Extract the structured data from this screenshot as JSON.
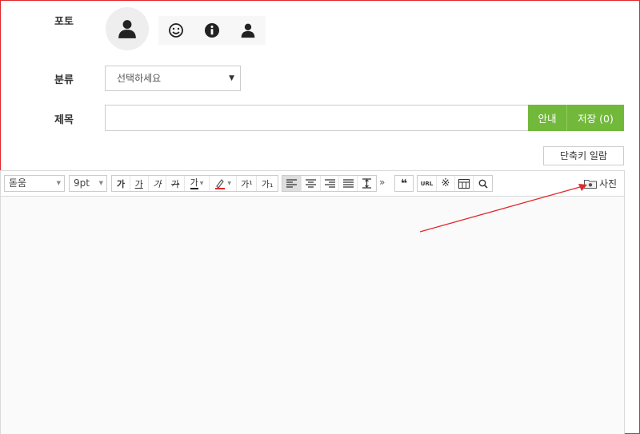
{
  "form": {
    "photo_label": "포토",
    "category_label": "분류",
    "title_label": "제목"
  },
  "photo_icons": [
    "user-silhouette-icon",
    "smiley-icon",
    "info-icon",
    "user-silhouette-icon"
  ],
  "category_select": {
    "selected": "선택하세요"
  },
  "title_input": {
    "value": ""
  },
  "buttons": {
    "guide": "안내",
    "save": "저장 (0)",
    "shortcut_list": "단축키 일람"
  },
  "toolbar": {
    "font_family": "돋움",
    "font_size": "9pt",
    "format_buttons": [
      "가",
      "가",
      "가",
      "가",
      "가",
      "",
      "가¹",
      "가₁"
    ],
    "url_label": "URL",
    "photo_label": "사진"
  },
  "colors": {
    "accent_green": "#72b93b",
    "frame_border": "#e0292b",
    "annotation_arrow": "#e0292b"
  }
}
